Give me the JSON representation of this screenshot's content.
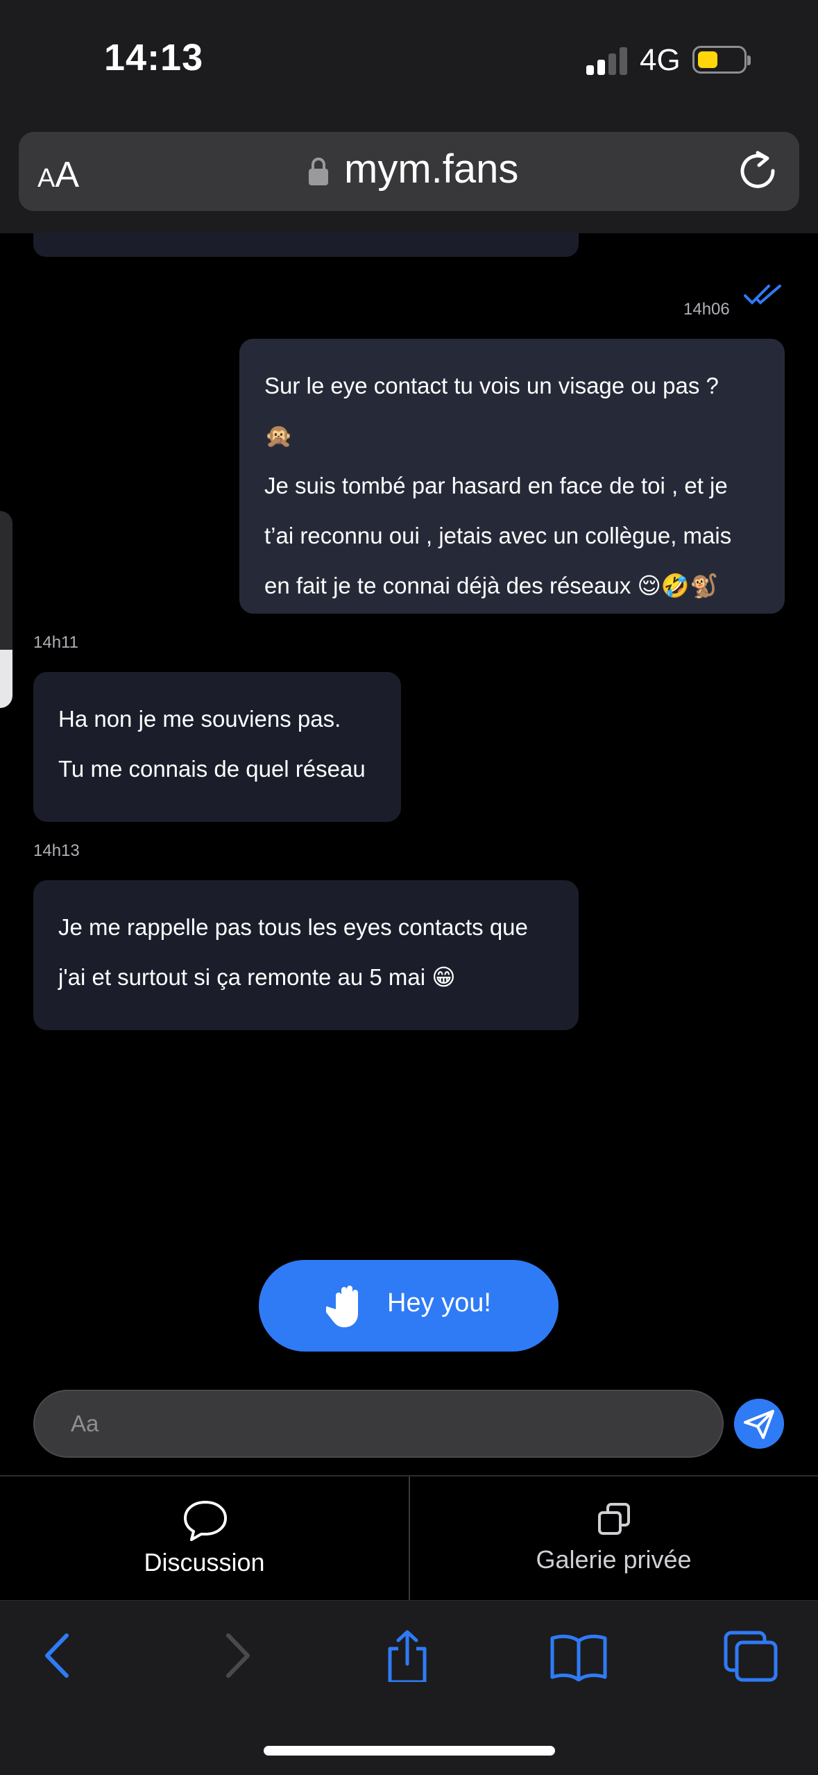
{
  "status": {
    "time": "14:13",
    "network": "4G",
    "battery_color": "#ffd60a"
  },
  "browser": {
    "text_size_label": "AA",
    "url": "mym.fans"
  },
  "messages": [
    {
      "time": "14h06",
      "direction": "outgoing",
      "read": true,
      "text": "Sur le eye contact tu vois un visage ou pas ?\n🙊\nJe suis tombé par hasard en face de toi , et je\nt’ai reconnu oui , jetais avec un collègue, mais\nen fait je te connai déjà des réseaux 😌🤣🐒"
    },
    {
      "time": "14h11",
      "direction": "incoming",
      "text": "Ha non je me souviens pas.\nTu me connais de quel réseau"
    },
    {
      "time": "14h13",
      "direction": "incoming",
      "text": "Je me rappelle pas tous les eyes contacts que\nj'ai et surtout si ça remonte au 5 mai 😁"
    }
  ],
  "quick_reply": {
    "label": "Hey you!"
  },
  "composer": {
    "placeholder": "Aa"
  },
  "tabs": [
    {
      "label": "Discussion",
      "active": true,
      "icon": "speech-bubble-icon"
    },
    {
      "label": "Galerie privée",
      "active": false,
      "icon": "gallery-copy-icon"
    }
  ],
  "colors": {
    "accent": "#2f7bf6",
    "bubble_in": "#1b1e2a",
    "bubble_out": "#262a38"
  }
}
